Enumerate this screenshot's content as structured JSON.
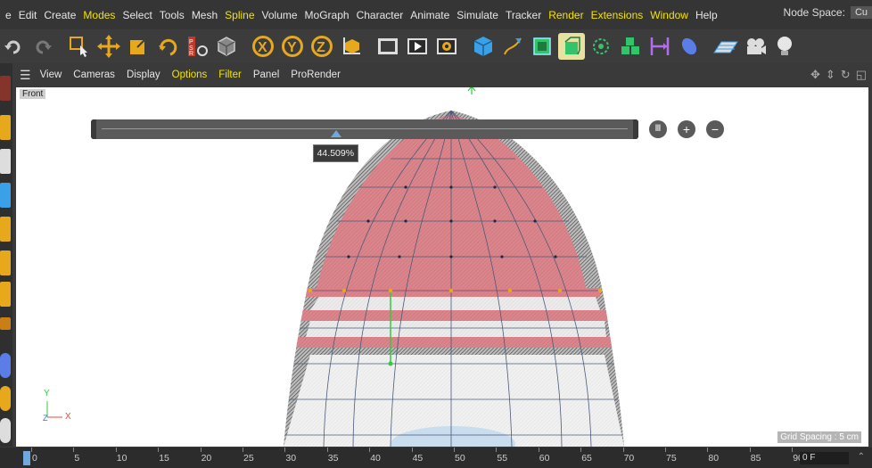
{
  "menu": {
    "items": [
      "e",
      "Edit",
      "Create",
      "Modes",
      "Select",
      "Tools",
      "Mesh",
      "Spline",
      "Volume",
      "MoGraph",
      "Character",
      "Animate",
      "Simulate",
      "Tracker",
      "Render",
      "Extensions",
      "Window",
      "Help"
    ],
    "highlight_items": [
      "Modes",
      "Spline",
      "Render",
      "Extensions",
      "Window"
    ],
    "node_space_label": "Node Space:",
    "node_space_value": "Cu"
  },
  "toolbar": {
    "icons": [
      "undo-icon",
      "redo-icon",
      "live-select-icon",
      "move-icon",
      "scale-icon",
      "rotate-icon",
      "psr-icon",
      "cube-recent-icon",
      "x-axis-icon",
      "y-axis-icon",
      "z-axis-icon",
      "coord-system-icon",
      "render-region-icon",
      "render-view-icon",
      "render-settings-icon",
      "cube-primitive-icon",
      "pen-spline-icon",
      "subdivision-icon",
      "extrude-icon",
      "cloner-icon",
      "mograph-icon",
      "boole-icon",
      "deformer-icon",
      "floor-icon",
      "camera-icon",
      "light-icon"
    ]
  },
  "viewport_menu": {
    "items": [
      "View",
      "Cameras",
      "Display",
      "Options",
      "Filter",
      "Panel",
      "ProRender"
    ],
    "highlight_items": [
      "Options",
      "Filter"
    ],
    "view_label": "Front"
  },
  "slider": {
    "value_label": "44.509%",
    "value_fraction": 0.44509
  },
  "axis": {
    "y": "Y",
    "z": "Z",
    "x": "X"
  },
  "grid_spacing": "Grid Spacing : 5 cm",
  "timeline": {
    "ticks": [
      "0",
      "5",
      "10",
      "15",
      "20",
      "25",
      "30",
      "35",
      "40",
      "45",
      "50",
      "55",
      "60",
      "65",
      "70",
      "75",
      "80",
      "85",
      "90"
    ],
    "frame_field": "0 F"
  },
  "colors": {
    "accent": "#e8a81c",
    "menu_highlight": "#f5e300",
    "mesh_red": "#e07c84",
    "viewport_bg": "#ffffff"
  }
}
